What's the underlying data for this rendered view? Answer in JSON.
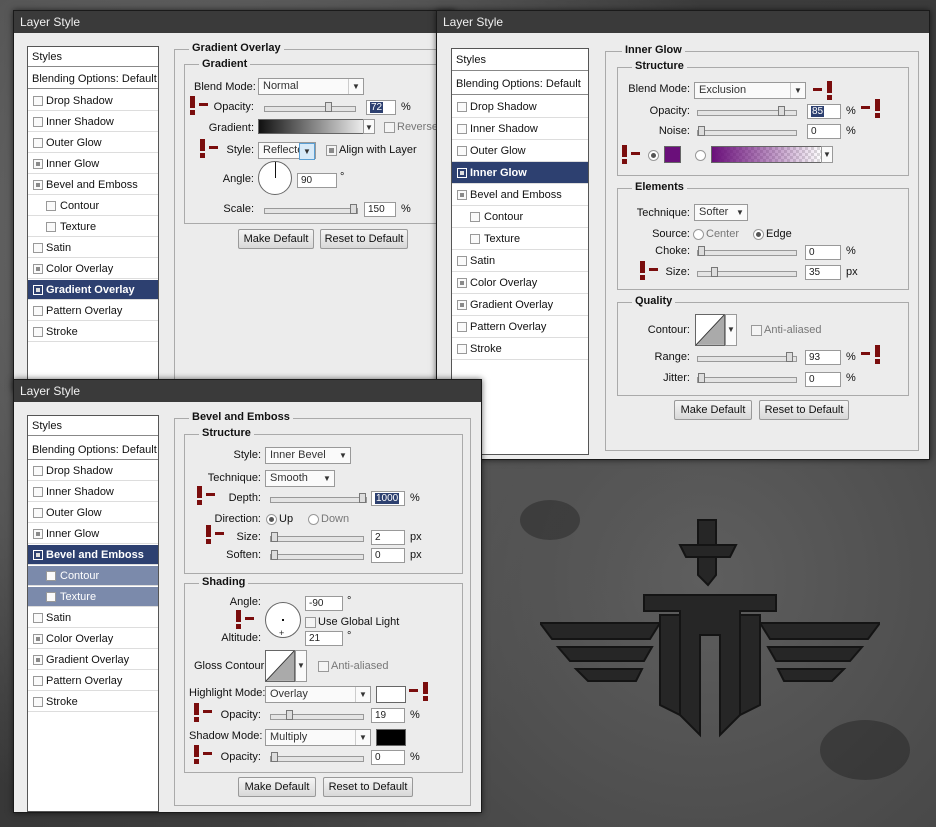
{
  "colors": {
    "titlebar": "#3a3a3a",
    "selected": "#2d4070",
    "warning": "#7a0d0d",
    "glow": "#6a0f7a"
  },
  "windows": {
    "gradient": {
      "title": "Layer Style",
      "styles": [
        "Styles",
        "Blending Options: Default",
        "Drop Shadow",
        "Inner Shadow",
        "Outer Glow",
        "Inner Glow",
        "Bevel and Emboss",
        "Contour",
        "Texture",
        "Satin",
        "Color Overlay",
        "Gradient Overlay",
        "Pattern Overlay",
        "Stroke"
      ],
      "section": "Gradient Overlay",
      "group": "Gradient",
      "blend_label": "Blend Mode:",
      "blend_value": "Normal",
      "opacity_label": "Opacity:",
      "opacity_value": "72",
      "opacity_unit": "%",
      "gradient_label": "Gradient:",
      "reverse_label": "Reverse",
      "style_label": "Style:",
      "style_value": "Reflected",
      "align_label": "Align with Layer",
      "angle_label": "Angle:",
      "angle_value": "90",
      "angle_unit": "°",
      "scale_label": "Scale:",
      "scale_value": "150",
      "scale_unit": "%",
      "make_default": "Make Default",
      "reset_default": "Reset to Default"
    },
    "inner_glow": {
      "title": "Layer Style",
      "styles": [
        "Styles",
        "Blending Options: Default",
        "Drop Shadow",
        "Inner Shadow",
        "Outer Glow",
        "Inner Glow",
        "Bevel and Emboss",
        "Contour",
        "Texture",
        "Satin",
        "Color Overlay",
        "Gradient Overlay",
        "Pattern Overlay",
        "Stroke"
      ],
      "section": "Inner Glow",
      "structure": "Structure",
      "blend_label": "Blend Mode:",
      "blend_value": "Exclusion",
      "opacity_label": "Opacity:",
      "opacity_value": "85",
      "opacity_unit": "%",
      "noise_label": "Noise:",
      "noise_value": "0",
      "noise_unit": "%",
      "elements": "Elements",
      "technique_label": "Technique:",
      "technique_value": "Softer",
      "source_label": "Source:",
      "source_center": "Center",
      "source_edge": "Edge",
      "choke_label": "Choke:",
      "choke_value": "0",
      "choke_unit": "%",
      "size_label": "Size:",
      "size_value": "35",
      "size_unit": "px",
      "quality": "Quality",
      "contour_label": "Contour:",
      "antialiased_label": "Anti-aliased",
      "range_label": "Range:",
      "range_value": "93",
      "range_unit": "%",
      "jitter_label": "Jitter:",
      "jitter_value": "0",
      "jitter_unit": "%",
      "make_default": "Make Default",
      "reset_default": "Reset to Default"
    },
    "bevel": {
      "title": "Layer Style",
      "styles": [
        "Styles",
        "Blending Options: Default",
        "Drop Shadow",
        "Inner Shadow",
        "Outer Glow",
        "Inner Glow",
        "Bevel and Emboss",
        "Contour",
        "Texture",
        "Satin",
        "Color Overlay",
        "Gradient Overlay",
        "Pattern Overlay",
        "Stroke"
      ],
      "section": "Bevel and Emboss",
      "structure": "Structure",
      "style_label": "Style:",
      "style_value": "Inner Bevel",
      "technique_label": "Technique:",
      "technique_value": "Smooth",
      "depth_label": "Depth:",
      "depth_value": "1000",
      "depth_unit": "%",
      "direction_label": "Direction:",
      "dir_up": "Up",
      "dir_down": "Down",
      "size_label": "Size:",
      "size_value": "2",
      "size_unit": "px",
      "soften_label": "Soften:",
      "soften_value": "0",
      "soften_unit": "px",
      "shading": "Shading",
      "angle_label": "Angle:",
      "angle_value": "-90",
      "angle_unit": "°",
      "global_light_label": "Use Global Light",
      "altitude_label": "Altitude:",
      "altitude_value": "21",
      "altitude_unit": "°",
      "gloss_label": "Gloss Contour:",
      "antialiased_label": "Anti-aliased",
      "highlight_label": "Highlight Mode:",
      "highlight_value": "Overlay",
      "hl_opacity_label": "Opacity:",
      "hl_opacity_value": "19",
      "hl_opacity_unit": "%",
      "shadow_label": "Shadow Mode:",
      "shadow_value": "Multiply",
      "sh_opacity_label": "Opacity:",
      "sh_opacity_value": "0",
      "sh_opacity_unit": "%",
      "make_default": "Make Default",
      "reset_default": "Reset to Default"
    }
  }
}
